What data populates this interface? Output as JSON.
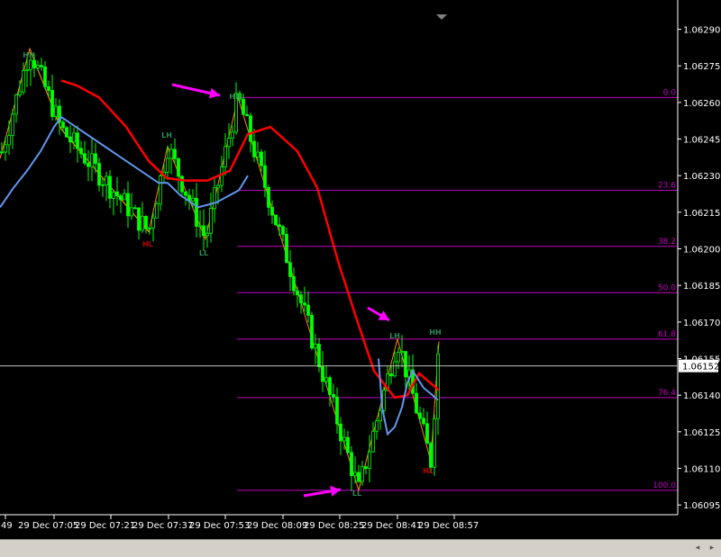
{
  "chart_data": {
    "type": "candlestick",
    "symbol_price_current": "1.06152",
    "y_axis": {
      "ticks": [
        "1.06290",
        "1.06275",
        "1.06260",
        "1.06245",
        "1.06230",
        "1.06215",
        "1.06200",
        "1.06185",
        "1.06170",
        "1.06155",
        "1.06140",
        "1.06125",
        "1.06110",
        "1.06095"
      ],
      "range": [
        1.06091,
        1.06302
      ]
    },
    "x_axis": {
      "ticks": [
        "49",
        "29 Dec 07:05",
        "29 Dec 07:21",
        "29 Dec 07:37",
        "29 Dec 07:53",
        "29 Dec 08:09",
        "29 Dec 08:25",
        "29 Dec 08:41",
        "29 Dec 08:57"
      ]
    },
    "fibonacci": {
      "levels": [
        "0.0",
        "23.6",
        "38.2",
        "50.0",
        "61.8",
        "76.4",
        "100.0"
      ],
      "prices": [
        1.06262,
        1.06224,
        1.06201,
        1.06182,
        1.06163,
        1.06139,
        1.06101
      ],
      "color": "#c000c0"
    },
    "swing_labels": [
      {
        "text": "HH",
        "color": "#2e8b57"
      },
      {
        "text": "LH",
        "color": "#2e8b57"
      },
      {
        "text": "HL",
        "color": "#c00000"
      },
      {
        "text": "LL",
        "color": "#2e8b57"
      },
      {
        "text": "HH",
        "color": "#2e8b57"
      },
      {
        "text": "LL",
        "color": "#2e8b57"
      },
      {
        "text": "LH",
        "color": "#2e8b57"
      },
      {
        "text": "HH",
        "color": "#2e8b57"
      },
      {
        "text": "HL",
        "color": "#c00000"
      }
    ],
    "colors": {
      "background": "#000000",
      "candle": "#00ff00",
      "zigzag": "#ff8c00",
      "red_ma": "#ff0000",
      "blue_ma": "#6495ed",
      "axis_text": "#ffffff",
      "arrow": "#ff00ff",
      "current_price_line": "#c0c0c0"
    }
  }
}
